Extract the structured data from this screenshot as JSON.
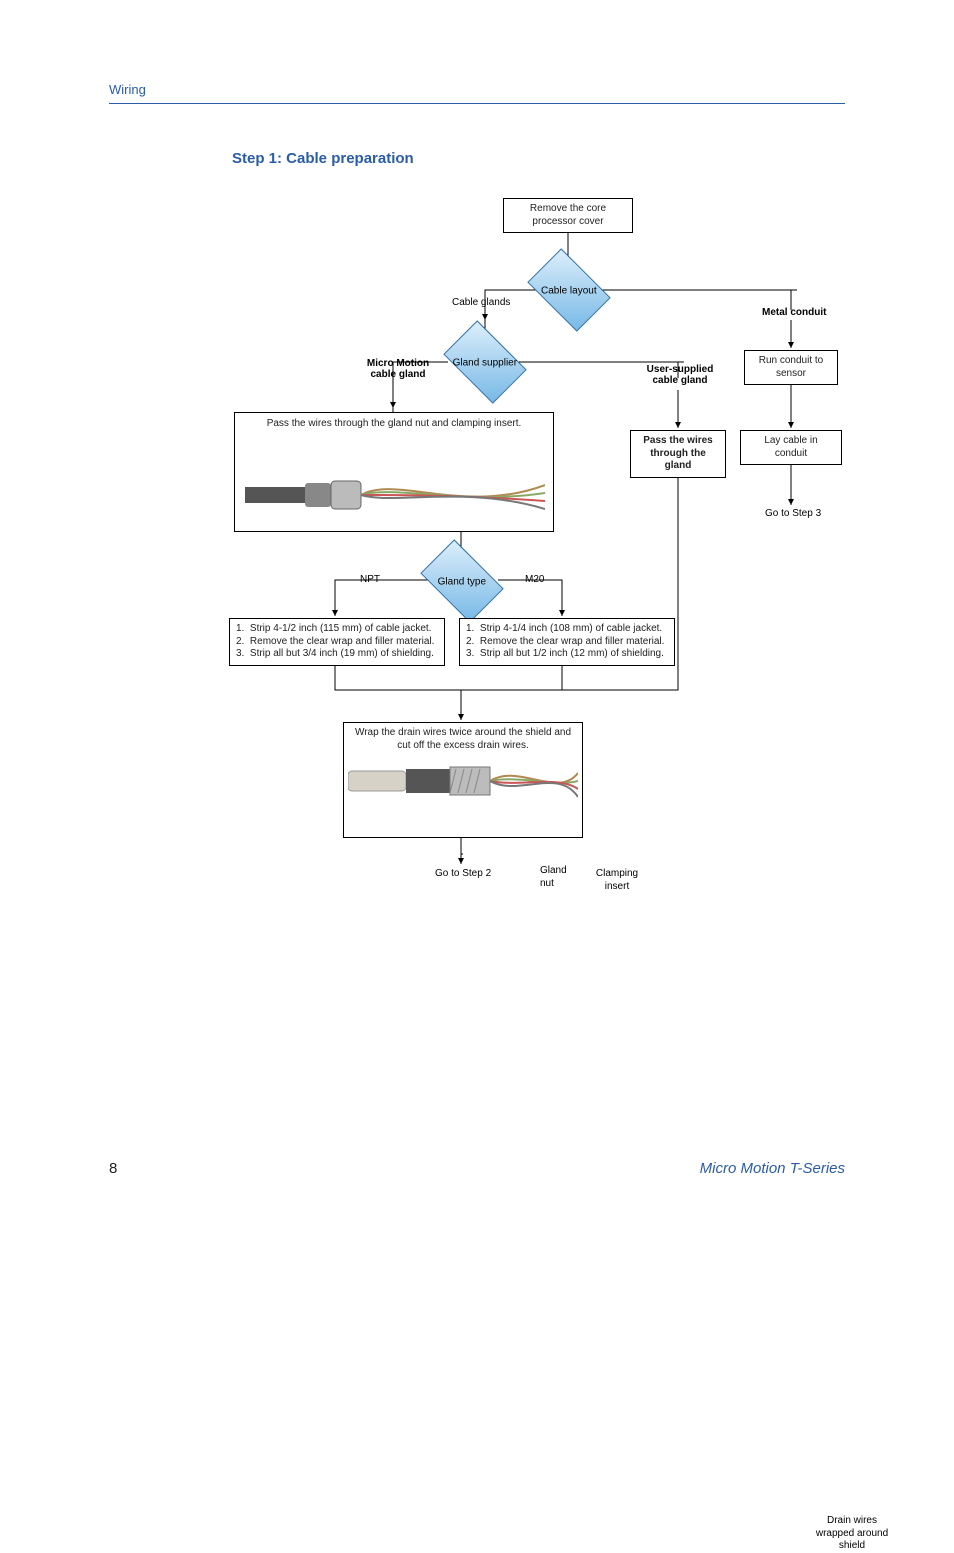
{
  "header": {
    "section": "Wiring"
  },
  "title": "Step 1: Cable preparation",
  "flow": {
    "start": "Remove the core processor cover",
    "d1": "Cable layout",
    "d1_left": "Cable glands",
    "d1_right": "Metal conduit",
    "d2": "Gland supplier",
    "d2_left": "Micro Motion cable gland",
    "d2_right": "User-supplied cable gland",
    "conduit_run": "Run conduit to sensor",
    "conduit_lay": "Lay cable in conduit",
    "conduit_goto": "Go to Step 3",
    "user_pass": "Pass the wires through the gland",
    "mm_pass": "Pass the wires through the gland nut and clamping insert.",
    "mm_lbl_nut": "Gland nut",
    "mm_lbl_insert": "Clamping insert",
    "d3": "Gland type",
    "d3_left": "NPT",
    "d3_right": "M20",
    "npt_steps": [
      "Strip 4-1/2 inch (115 mm) of cable jacket.",
      "Remove the clear wrap and filler material.",
      "Strip all but 3/4 inch (19 mm) of shielding."
    ],
    "m20_steps": [
      "Strip 4-1/4 inch (108 mm) of cable jacket.",
      "Remove the clear wrap and filler material.",
      "Strip all but 1/2 inch (12 mm) of shielding."
    ],
    "wrap": "Wrap the drain wires twice around the shield and cut off the excess drain wires.",
    "wrap_lbl": "Drain wires wrapped around shield",
    "goto2": "Go to Step 2"
  },
  "footer": {
    "page": "8",
    "doc": "Micro Motion T-Series"
  }
}
